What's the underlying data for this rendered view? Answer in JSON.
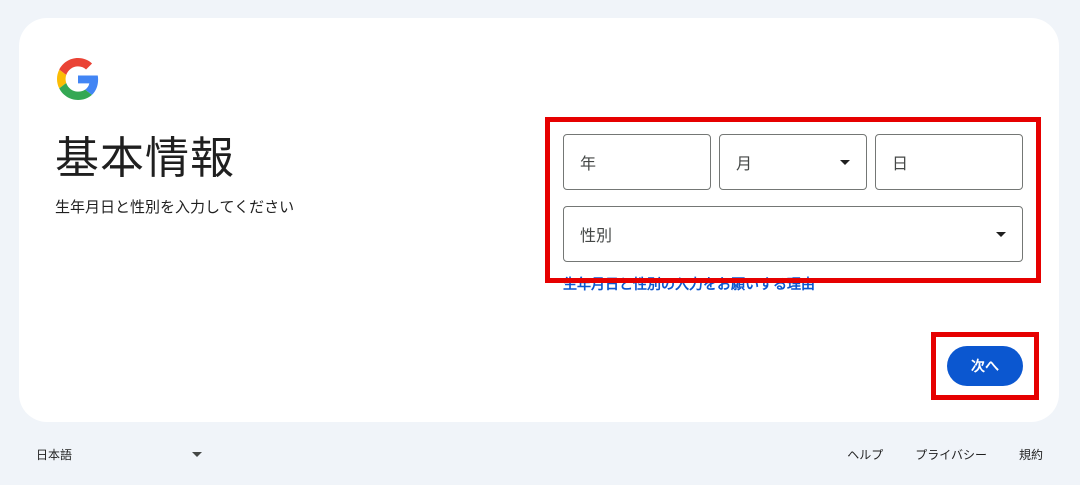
{
  "page": {
    "title": "基本情報",
    "subtitle": "生年月日と性別を入力してください"
  },
  "logo": {
    "icon": "google-g-logo-icon"
  },
  "form": {
    "year_placeholder": "年",
    "month_placeholder": "月",
    "day_placeholder": "日",
    "gender_placeholder": "性別",
    "why_link": "生年月日と性別の入力をお願いする理由"
  },
  "actions": {
    "next_label": "次へ"
  },
  "footer": {
    "language": "日本語",
    "help": "ヘルプ",
    "privacy": "プライバシー",
    "terms": "規約"
  },
  "colors": {
    "background": "#f0f4f9",
    "card": "#ffffff",
    "accent": "#0b57d0",
    "highlight": "#e60000"
  }
}
